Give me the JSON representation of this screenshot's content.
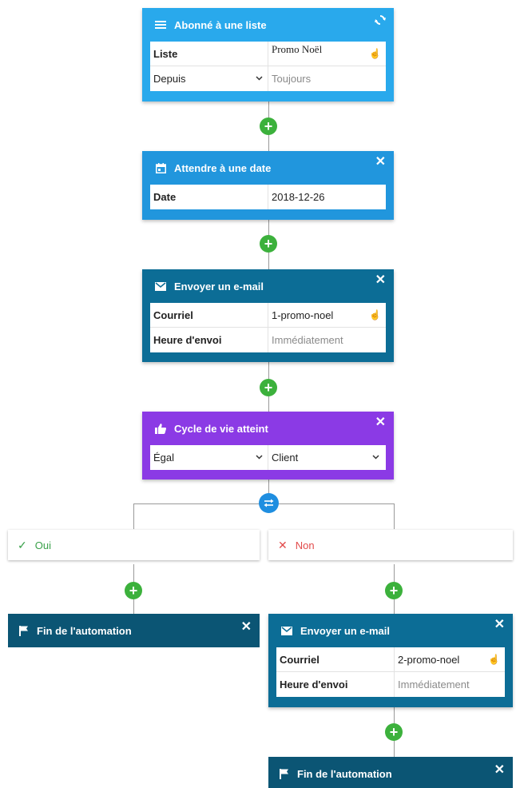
{
  "colors": {
    "subscribe": "#29a9ec",
    "wait": "#2196dd",
    "email": "#0c6d96",
    "lifecycle": "#8b3ae5",
    "end": "#0b5574",
    "add": "#3cb13c",
    "split": "#1f8ee0",
    "yes": "#3aa14a",
    "no": "#e24b4b"
  },
  "icons": {
    "subscribe": "list-icon",
    "refresh": "refresh-icon",
    "calendar": "calendar-icon",
    "envelope": "envelope-icon",
    "thumbs": "thumbs-up-icon",
    "flag": "flag-icon",
    "close": "close-icon",
    "split": "split-icon",
    "hand": "pointer-hand-icon"
  },
  "step1": {
    "title": "Abonné à une liste",
    "rows": [
      {
        "label": "Liste",
        "value": "Promo Noël"
      },
      {
        "label": "Depuis",
        "value": "Toujours"
      }
    ]
  },
  "step2": {
    "title": "Attendre à une date",
    "rows": [
      {
        "label": "Date",
        "value": "2018-12-26"
      }
    ]
  },
  "step3": {
    "title": "Envoyer un e-mail",
    "rows": [
      {
        "label": "Courriel",
        "value": "1-promo-noel"
      },
      {
        "label": "Heure d'envoi",
        "value": "Immédiatement"
      }
    ]
  },
  "step4": {
    "title": "Cycle de vie atteint",
    "rows": [
      {
        "label": "Égal",
        "value": "Client"
      }
    ]
  },
  "branch_yes": {
    "label": "Oui",
    "check": "✓"
  },
  "branch_no": {
    "label": "Non",
    "cross": "✕"
  },
  "end_left": {
    "title": "Fin de l'automation"
  },
  "step5": {
    "title": "Envoyer un e-mail",
    "rows": [
      {
        "label": "Courriel",
        "value": "2-promo-noel"
      },
      {
        "label": "Heure d'envoi",
        "value": "Immédiatement"
      }
    ]
  },
  "end_right": {
    "title": "Fin de l'automation"
  },
  "glyphs": {
    "plus": "+",
    "close": "✕",
    "chevron": "⌄",
    "hand": "☝"
  }
}
